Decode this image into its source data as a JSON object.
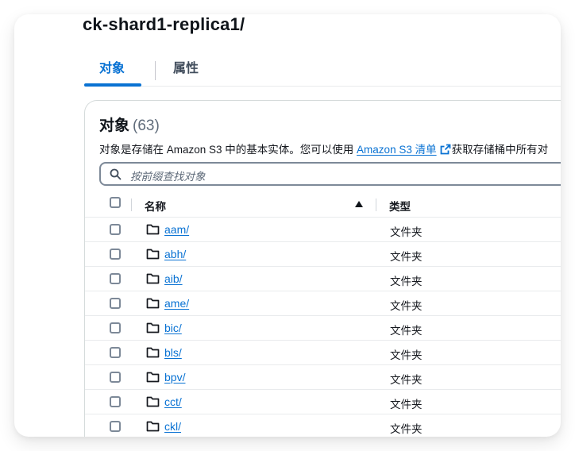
{
  "page": {
    "title": "ck-shard1-replica1/"
  },
  "tabs": [
    {
      "label": "对象",
      "active": true
    },
    {
      "label": "属性",
      "active": false
    }
  ],
  "objects_panel": {
    "title": "对象",
    "count": "(63)",
    "description_prefix": "对象是存储在 Amazon S3 中的基本实体。您可以使用 ",
    "description_link": "Amazon S3 清单",
    "description_suffix": "获取存储桶中所有对",
    "search": {
      "placeholder": "按前缀查找对象"
    },
    "table": {
      "columns": {
        "name": "名称",
        "type": "类型"
      },
      "rows": [
        {
          "name": "aam/",
          "type": "文件夹"
        },
        {
          "name": "abh/",
          "type": "文件夹"
        },
        {
          "name": "aib/",
          "type": "文件夹"
        },
        {
          "name": "ame/",
          "type": "文件夹"
        },
        {
          "name": "bic/",
          "type": "文件夹"
        },
        {
          "name": "bls/",
          "type": "文件夹"
        },
        {
          "name": "bpv/",
          "type": "文件夹"
        },
        {
          "name": "cct/",
          "type": "文件夹"
        },
        {
          "name": "ckl/",
          "type": "文件夹"
        }
      ]
    }
  },
  "icons": {
    "search": "search-icon",
    "folder": "folder-icon",
    "external_link": "external-link-icon",
    "sort": "sort-ascending-icon"
  },
  "colors": {
    "accent": "#0972d3",
    "text": "#16191f",
    "muted": "#5f6b7a",
    "border": "#7d8998"
  }
}
